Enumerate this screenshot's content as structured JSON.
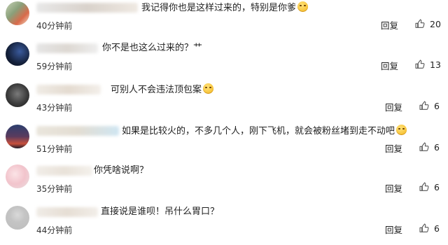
{
  "comments": [
    {
      "text": "我记得你也是这样过来的，特别是你爹",
      "emoji": "grin-emoji",
      "time": "40分钟前",
      "reply_label": "回复",
      "likes": "20"
    },
    {
      "text": "你不是也这么过来的？艹",
      "emoji": "",
      "time": "59分钟前",
      "reply_label": "回复",
      "likes": "13"
    },
    {
      "text": "可别人不会违法顶包案",
      "emoji": "wink-emoji",
      "time": "43分钟前",
      "reply_label": "回复",
      "likes": "6"
    },
    {
      "text": "如果是比较火的，不多几个人，刚下飞机，就会被粉丝堵到走不动吧",
      "emoji": "sweat-emoji",
      "time": "51分钟前",
      "reply_label": "回复",
      "likes": "6"
    },
    {
      "text": "你凭啥说啊？",
      "emoji": "",
      "time": "35分钟前",
      "reply_label": "回复",
      "likes": "6"
    },
    {
      "text": "直接说是谁呗！吊什么胃口？",
      "emoji": "",
      "time": "44分钟前",
      "reply_label": "回复",
      "likes": "6"
    }
  ],
  "colors": {
    "text": "#222222",
    "time": "#333333",
    "name_blur": "#eae3dc"
  },
  "icons": {
    "like": "thumbs-up-icon"
  }
}
